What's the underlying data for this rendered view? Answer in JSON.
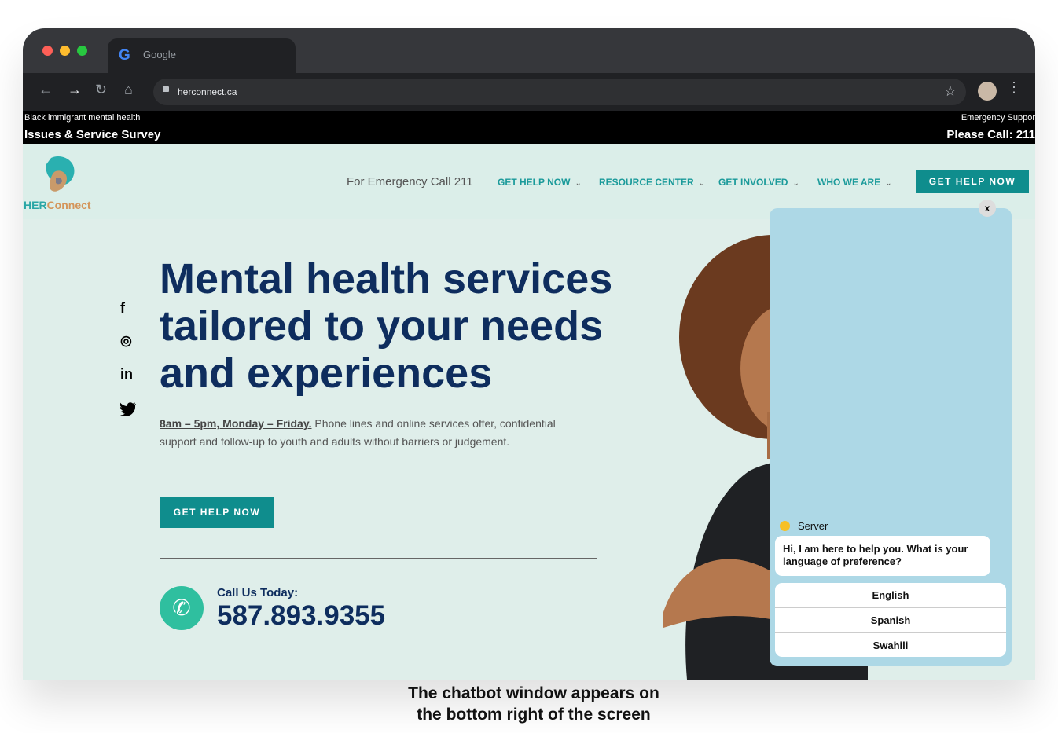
{
  "browser": {
    "tab_title": "Google",
    "url": "herconnect.ca"
  },
  "banner": {
    "left_small": "Black immigrant mental health",
    "left_large": "Issues & Service Survey",
    "right_small": "Emergency Suppor",
    "right_large": "Please Call: 211"
  },
  "header": {
    "logo_her": "HER",
    "logo_connect": "Connect",
    "emergency_text": "For Emergency Call 211",
    "menu": [
      {
        "label": "GET HELP NOW"
      },
      {
        "label": "RESOURCE CENTER"
      },
      {
        "label": "GET INVOLVED"
      },
      {
        "label": "WHO WE ARE"
      }
    ],
    "cta": "GET HELP NOW"
  },
  "hero": {
    "headline": "Mental health services tailored to your needs and experiences",
    "hours": "8am – 5pm, Monday – Friday.",
    "description": " Phone lines and online services offer, confidential support and follow-up to youth and adults without barriers or judgement.",
    "cta": "GET HELP NOW",
    "call_label": "Call Us Today:",
    "phone": "587.893.9355"
  },
  "social": [
    "facebook-icon",
    "instagram-icon",
    "linkedin-icon",
    "twitter-icon"
  ],
  "chatbot": {
    "close": "x",
    "sender": "Server",
    "message": "Hi, I am here to help you. What is your language of preference?",
    "options": [
      "English",
      "Spanish",
      "Swahili"
    ]
  },
  "caption": {
    "line1": "The chatbot window appears on",
    "line2": "the bottom right of the screen"
  },
  "colors": {
    "teal": "#0f8d8d",
    "navy": "#0e2d5e",
    "chat_bg": "#add8e6"
  }
}
